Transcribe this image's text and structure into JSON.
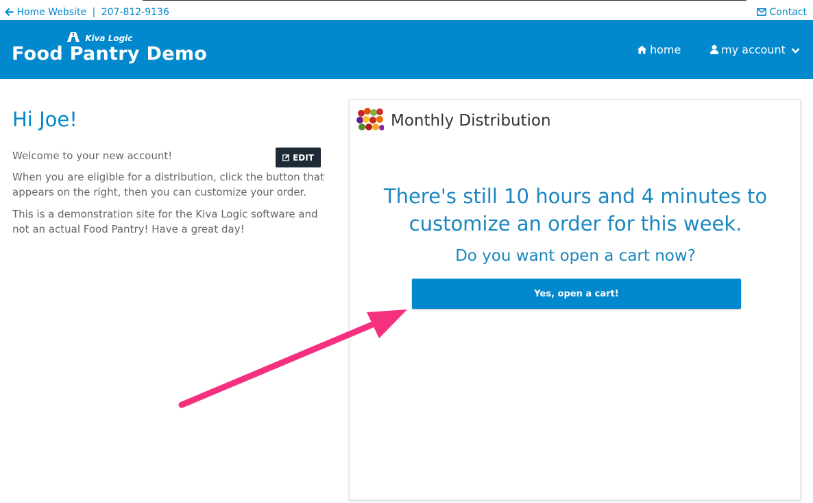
{
  "topbar": {
    "home_link": "Home Website",
    "separator": "|",
    "phone": "207-812-9136",
    "contact_link": "Contact"
  },
  "header": {
    "brand_sub": "Kiva Logic",
    "brand_title": "Food Pantry Demo",
    "nav_home": "home",
    "nav_account": "my account"
  },
  "welcome": {
    "greeting": "Hi Joe!",
    "edit_label": "EDIT",
    "paragraphs": [
      "Welcome to your new account!",
      "When you are eligible for a distribution, click the button that appears on the right, then you can customize your order.",
      "This is a demonstration site for the Kiva Logic software and not an actual Food Pantry! Have a great day!"
    ]
  },
  "distribution": {
    "title": "Monthly Distribution",
    "countdown": "There's still 10 hours and 4 minutes to customize an order for this week.",
    "question": "Do you want open a cart now?",
    "cart_button": "Yes, open a cart!"
  },
  "icons": {
    "back": "arrow-left-icon",
    "contact": "envelope-icon",
    "home": "home-icon",
    "account": "user-icon",
    "chevron": "chevron-down-icon",
    "edit": "edit-icon",
    "produce": "produce-thumbnail"
  },
  "colors": {
    "brand_blue": "#0288cc",
    "edit_button": "#1e2a36",
    "annotation_arrow": "#f5317f"
  }
}
